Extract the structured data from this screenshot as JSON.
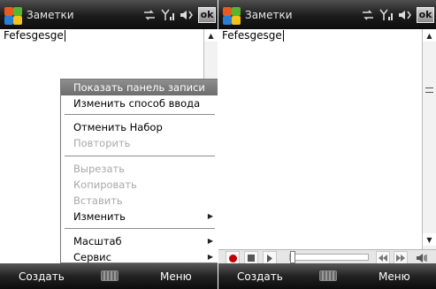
{
  "left": {
    "title": "Заметки",
    "ok_label": "ok",
    "doc_text": "Fefesgesge",
    "menu": {
      "items": [
        {
          "label": "Показать панель записи",
          "state": "highlighted"
        },
        {
          "label": "Изменить способ ввода",
          "state": "enabled"
        },
        {
          "label": "Отменить Набор",
          "state": "enabled"
        },
        {
          "label": "Повторить",
          "state": "disabled"
        },
        {
          "label": "Вырезать",
          "state": "disabled"
        },
        {
          "label": "Копировать",
          "state": "disabled"
        },
        {
          "label": "Вставить",
          "state": "disabled"
        },
        {
          "label": "Изменить",
          "state": "enabled",
          "submenu": true
        },
        {
          "label": "Масштаб",
          "state": "enabled",
          "submenu": true
        },
        {
          "label": "Сервис",
          "state": "enabled",
          "submenu": true
        }
      ]
    },
    "softkeys": {
      "left": "Создать",
      "right": "Меню"
    }
  },
  "right": {
    "title": "Заметки",
    "ok_label": "ok",
    "doc_text": "Fefesgesge",
    "recorder": {
      "record_color": "#c00000",
      "progress": 0
    },
    "softkeys": {
      "left": "Создать",
      "right": "Меню"
    }
  },
  "colors": {
    "titlebar": "#1b1b1b",
    "highlight": "#7d7d7d",
    "record": "#c00000"
  }
}
